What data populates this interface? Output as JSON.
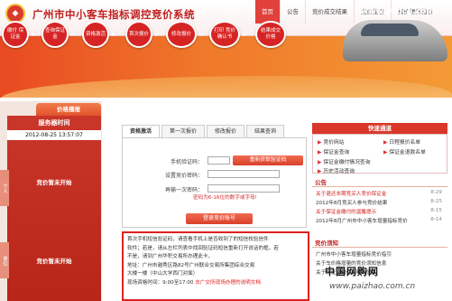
{
  "header": {
    "title": "广州市中小客车指标调控竞价系统",
    "nav": [
      "首页",
      "公告",
      "竞价成交结果",
      "竞价指引",
      "报价操作指引"
    ]
  },
  "banner": {
    "url": "www.gzqcjj.com",
    "steps": [
      "缴付\n保证金",
      "查询保证金",
      "资格激活",
      "首次报价",
      "修改报价",
      "打印\n竞价确认书",
      "结果成交价格"
    ]
  },
  "left": {
    "price_tab": "价格播报",
    "server_time_label": "服务器时间",
    "server_time": "2012-08-25 13:57:07",
    "personal_label": "个人",
    "personal_status": "竞价暂未开始",
    "company_label": "单位",
    "company_status": "竞价暂未开始"
  },
  "tabs": [
    "资格激活",
    "第一次报价",
    "修改报价",
    "结果查询"
  ],
  "form": {
    "phone_label": "手机验证码：",
    "get_code": "重新获取验证码",
    "set_pw_label": "设置竞价密码：",
    "repeat_pw_label": "再输一次密码：",
    "pw_hint": "密码为6-16位的数字或字母!",
    "login": "登录竞价账号"
  },
  "notice": {
    "lines": [
      "首次手机短信验证码，请查看手机上是否收到了的短信校验信件",
      "软件；若是，请从左栏列表中找回验证码短信重新打开说话的框。若",
      "不是，请到广州华积交易所办理此卡，",
      "地址：广州市越秀区路82号广州联合交易所集团综合交易",
      "大楼一楼（中山大学西门对面）"
    ],
    "last_prefix": "现场资格时间：9:00至17:00",
    "last_link": "去广交所现场办理的说明文档"
  },
  "quick": {
    "title": "快速通道",
    "links": [
      "竞价网站",
      "保证金查询",
      "保证金缴付情况查询",
      "历史活动查询",
      "日程报价名单",
      "保证金退款名单"
    ]
  },
  "announce": {
    "title": "公告",
    "items": [
      {
        "text": "关于退还本期竞买人竞价保证金",
        "date": "8-29"
      },
      {
        "text": "2012年8月竞买人参与竞价结果",
        "date": "8-25"
      },
      {
        "text": "关于保证金缴付的温馨提示",
        "date": "8-15"
      },
      {
        "text": "2012年8月广州市中小客车增量指标竞价",
        "date": "8-14"
      }
    ]
  },
  "guide": {
    "title": "竞价须知",
    "items": [
      "广州市中小客车增量指标竞价指引",
      "关于车价格增量的竞价须知信息",
      "关于保证金缴付说明的信息"
    ]
  },
  "watermark": {
    "cn": "中国网购网",
    "url": "www.paizhao.com.cn"
  }
}
